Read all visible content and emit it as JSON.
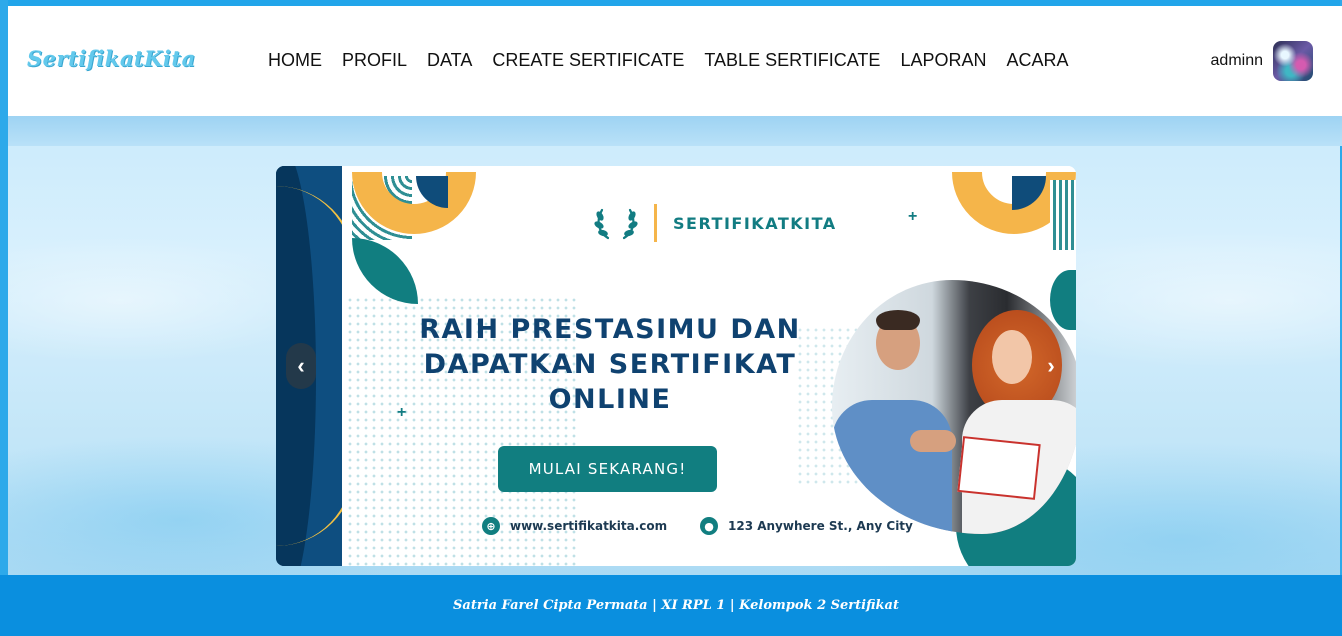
{
  "navbar": {
    "brand": "SertifikatKita",
    "links": [
      "HOME",
      "PROFIL",
      "DATA",
      "CREATE SERTIFICATE",
      "TABLE SERTIFICATE",
      "LAPORAN",
      "ACARA"
    ],
    "user_name": "adminn"
  },
  "banner": {
    "logo_text": "SERTIFIKATKITA",
    "headline": "RAIH PRESTASIMU DAN DAPATKAN SERTIFIKAT ONLINE",
    "cta_label": "MULAI SEKARANG!",
    "website": "www.sertifikatkita.com",
    "address": "123 Anywhere St., Any City"
  },
  "carousel": {
    "prev_symbol": "‹",
    "next_symbol": "›"
  },
  "footer": {
    "text": "Satria Farel Cipta Permata | XI RPL 1 | Kelompok 2 Sertifikat"
  },
  "colors": {
    "nav_bg": "#ffffff",
    "brand": "#63c9ec",
    "footer_bg": "#0a8fdf",
    "banner_teal": "#117e80",
    "banner_navy": "#0f4270",
    "banner_gold": "#f5b54a"
  },
  "icons": {
    "globe": "globe-icon",
    "location": "location-pin-icon",
    "laurel": "laurel-icon"
  }
}
